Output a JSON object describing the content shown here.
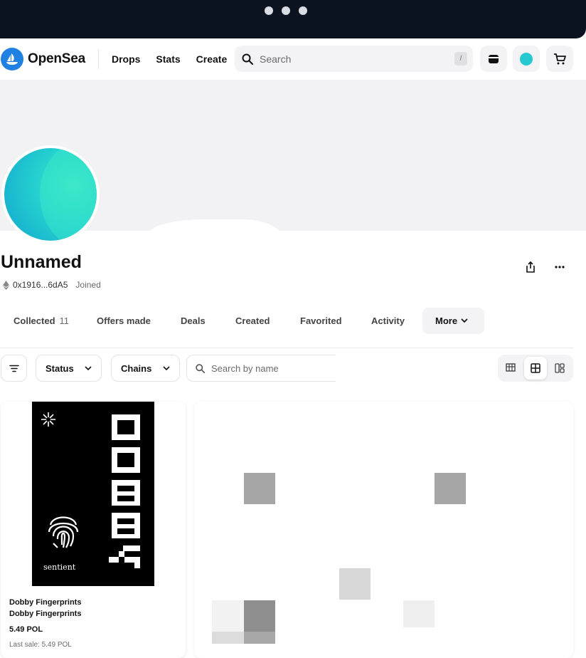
{
  "nav": {
    "logo_text": "OpenSea",
    "links": [
      "Drops",
      "Stats",
      "Create"
    ],
    "search_placeholder": "Search",
    "search_shortcut": "/"
  },
  "profile": {
    "name": "Unnamed",
    "address": "0x1916...6dA5",
    "joined": "Joined"
  },
  "tabs": [
    {
      "label": "Collected",
      "count": "11"
    },
    {
      "label": "Offers made"
    },
    {
      "label": "Deals"
    },
    {
      "label": "Created"
    },
    {
      "label": "Favorited"
    },
    {
      "label": "Activity"
    },
    {
      "label": "More"
    }
  ],
  "filters": {
    "status": "Status",
    "chains": "Chains",
    "search_placeholder": "Search by name"
  },
  "items": [
    {
      "collection": "Dobby Fingerprints",
      "name": "Dobby Fingerprints",
      "price": "5.49 POL",
      "last_sale": "Last sale: 5.49 POL",
      "art_brand": "sentient"
    }
  ],
  "colors": {
    "brand": "#2081e2",
    "topbar": "#0b1220",
    "avatar": "#25d3cf"
  }
}
